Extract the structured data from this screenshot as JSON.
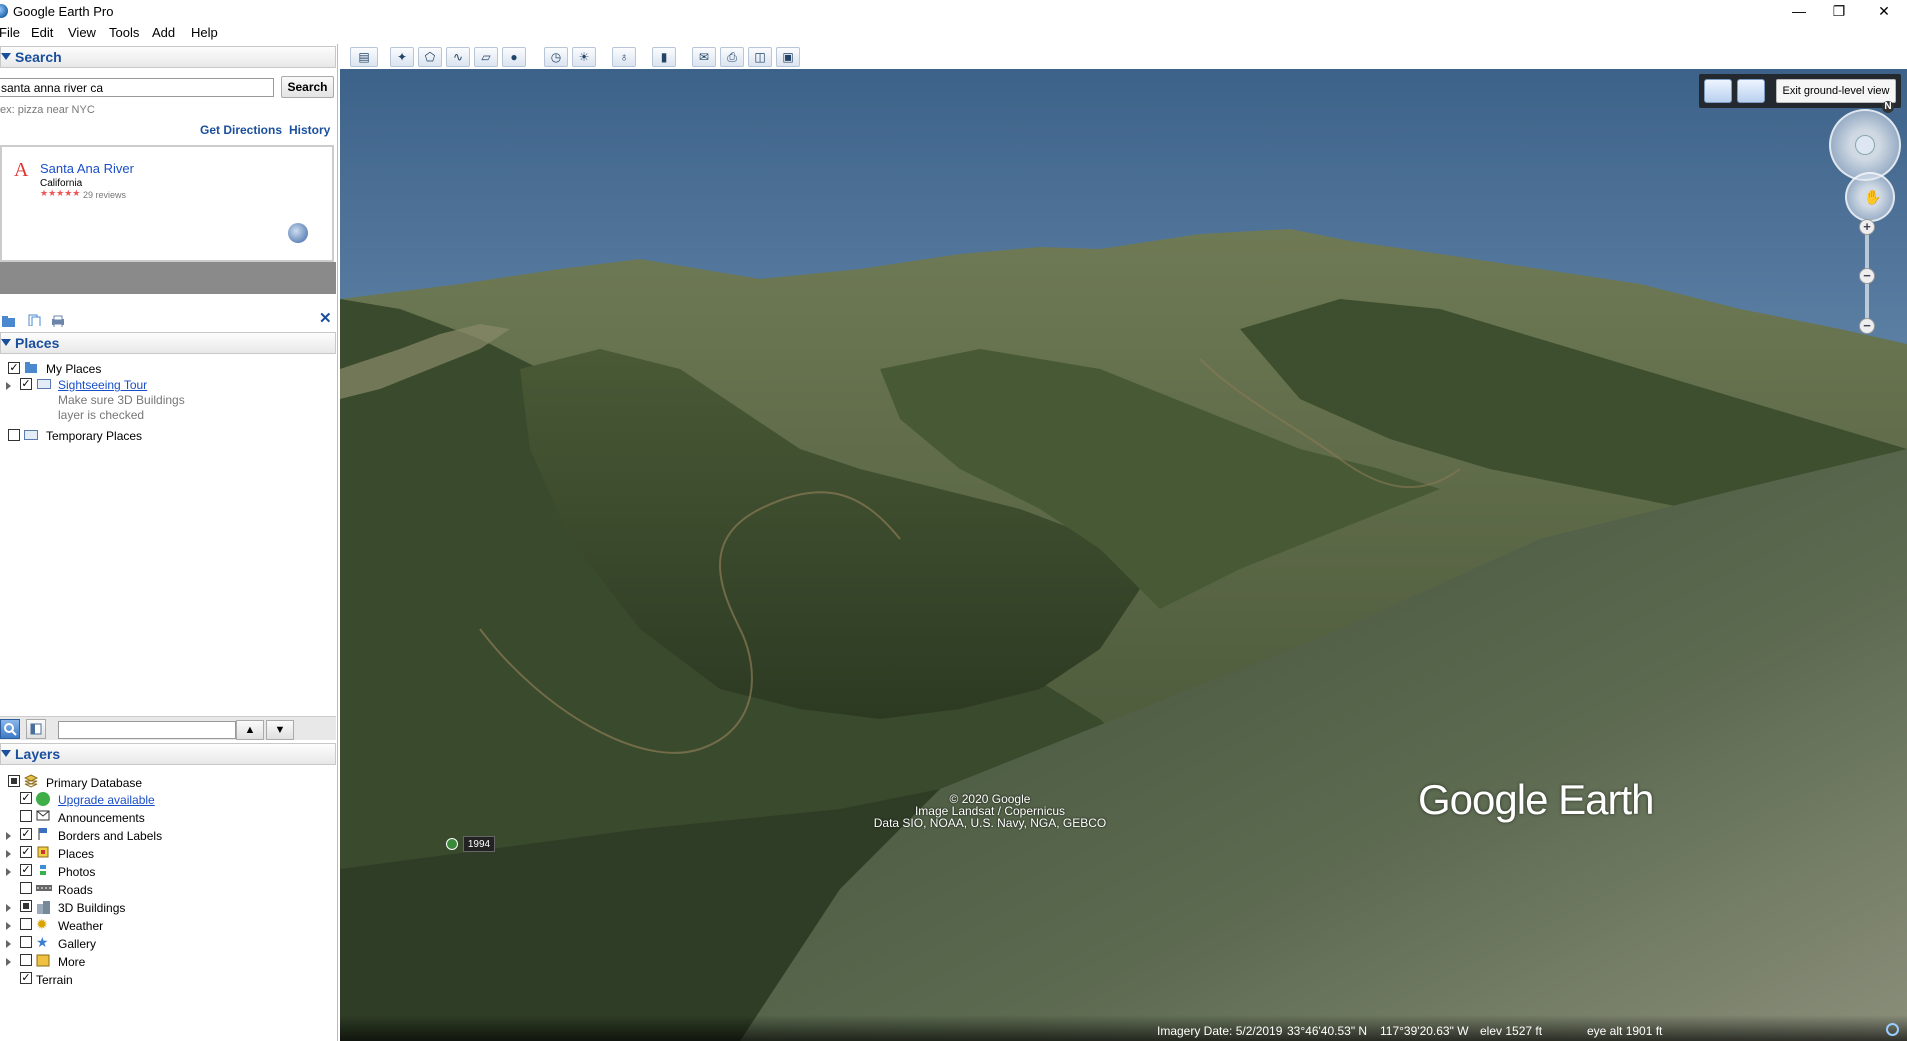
{
  "window": {
    "title": "Google Earth Pro",
    "minimize": "—",
    "maximize": "❐",
    "close": "✕"
  },
  "menu": [
    "File",
    "Edit",
    "View",
    "Tools",
    "Add",
    "Help"
  ],
  "search": {
    "header": "Search",
    "query": "santa anna river ca",
    "button": "Search",
    "hint": "ex: pizza near NYC",
    "get_directions": "Get Directions",
    "history": "History",
    "result": {
      "marker": "A",
      "name": "Santa Ana River",
      "location": "California",
      "stars": "★★★★★",
      "reviews": "29 reviews"
    }
  },
  "places": {
    "header": "Places",
    "items": [
      {
        "label": "My Places",
        "checked": true
      },
      {
        "label": "Sightseeing Tour",
        "checked": true,
        "note1": "Make sure 3D Buildings",
        "note2": "layer is checked"
      },
      {
        "label": "Temporary Places",
        "checked": false
      }
    ]
  },
  "layers": {
    "header": "Layers",
    "items": [
      {
        "label": "Primary Database"
      },
      {
        "label": "Upgrade available"
      },
      {
        "label": "Announcements"
      },
      {
        "label": "Borders and Labels"
      },
      {
        "label": "Places"
      },
      {
        "label": "Photos"
      },
      {
        "label": "Roads"
      },
      {
        "label": "3D Buildings"
      },
      {
        "label": "Weather"
      },
      {
        "label": "Gallery"
      },
      {
        "label": "More"
      },
      {
        "label": "Terrain"
      }
    ]
  },
  "view": {
    "exit_ground": "Exit ground-level view",
    "compass_north": "N",
    "zoom_in": "+",
    "zoom_out": "−",
    "copyright": [
      "© 2020 Google",
      "Image Landsat / Copernicus",
      "Data SIO, NOAA, U.S. Navy, NGA, GEBCO"
    ],
    "logo": "Google Earth",
    "history_year": "1994",
    "status": {
      "imagery_date": "Imagery Date: 5/2/2019",
      "lat": "33°46'40.53\" N",
      "lon": "117°39'20.63\" W",
      "elev": "elev  1527 ft",
      "eye_alt": "eye alt  1901 ft"
    }
  }
}
